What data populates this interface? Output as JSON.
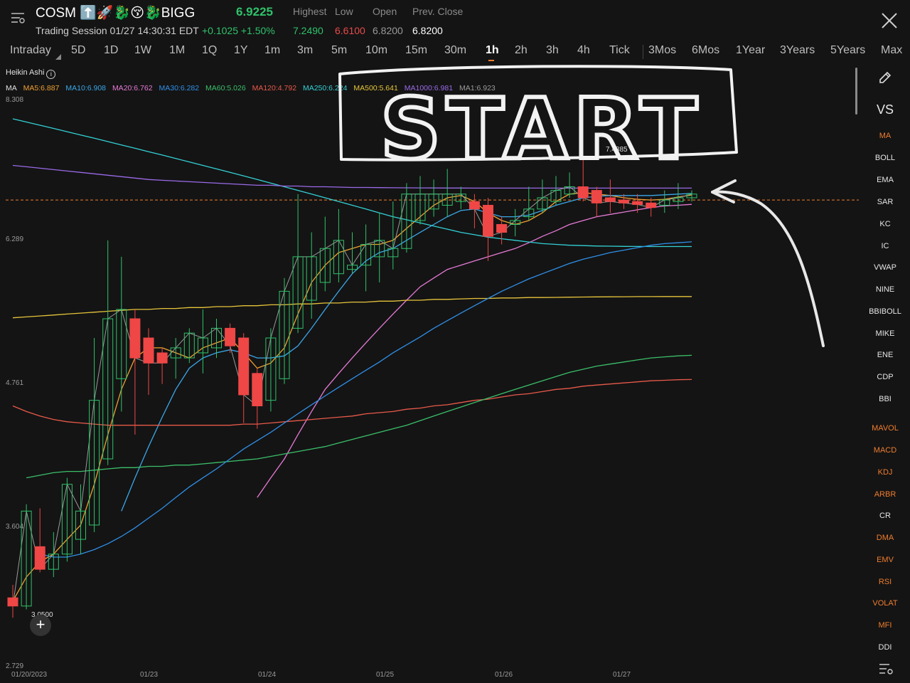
{
  "header": {
    "symbol": "COSM ⬆️🚀🐉😚🐉BIGG",
    "price": "6.9225",
    "session": "Trading Session 01/27 14:30:31 EDT",
    "change": "+0.1025 +1.50%",
    "stats": [
      {
        "label": "Highest",
        "value": "7.2490",
        "color": "#2fc26b"
      },
      {
        "label": "Low",
        "value": "6.6100",
        "color": "#e84a4a"
      },
      {
        "label": "Open",
        "value": "6.8200",
        "color": "#9a9a9a"
      },
      {
        "label": "Prev. Close",
        "value": "6.8200",
        "color": "#ffffff"
      }
    ]
  },
  "periods": [
    "Intraday",
    "5D",
    "1D",
    "1W",
    "1M",
    "1Q",
    "1Y",
    "1m",
    "3m",
    "5m",
    "10m",
    "15m",
    "30m",
    "1h",
    "2h",
    "3h",
    "4h",
    "Tick",
    "3Mos",
    "6Mos",
    "1Year",
    "3Years",
    "5Years",
    "Max"
  ],
  "active_period": "1h",
  "chart_header": {
    "style": "Heikin Ashi",
    "ma_label": "MA",
    "ma_items": [
      {
        "text": "MA5:6.887",
        "color": "#f0a030"
      },
      {
        "text": "MA10:6.908",
        "color": "#3aa7e8"
      },
      {
        "text": "MA20:6.762",
        "color": "#e67ad6"
      },
      {
        "text": "MA30:6.282",
        "color": "#2f8fe8"
      },
      {
        "text": "MA60:5.026",
        "color": "#3bbf6a"
      },
      {
        "text": "MA120:4.792",
        "color": "#e8594a"
      },
      {
        "text": "MA250:6.224",
        "color": "#33d0d6"
      },
      {
        "text": "MA500:5.641",
        "color": "#e6c43a"
      },
      {
        "text": "MA1000:6.981",
        "color": "#9a6ae8"
      },
      {
        "text": "MA1:6.923",
        "color": "#9a9a9a"
      }
    ]
  },
  "y_labels": [
    "8.308",
    "6.289",
    "4.761",
    "3.604",
    "2.729"
  ],
  "x_labels": [
    "01/20/2023",
    "01/23",
    "01/24",
    "01/25",
    "01/26",
    "01/27"
  ],
  "markers": {
    "low": "3.0500",
    "high": "7.4385"
  },
  "annotation": "START",
  "sidebar": [
    {
      "label": "MA",
      "on": true
    },
    {
      "label": "BOLL",
      "on": false
    },
    {
      "label": "EMA",
      "on": false
    },
    {
      "label": "SAR",
      "on": false
    },
    {
      "label": "KC",
      "on": false
    },
    {
      "label": "IC",
      "on": false
    },
    {
      "label": "VWAP",
      "on": false
    },
    {
      "label": "NINE",
      "on": false
    },
    {
      "label": "BBIBOLL",
      "on": false
    },
    {
      "label": "MIKE",
      "on": false
    },
    {
      "label": "ENE",
      "on": false
    },
    {
      "label": "CDP",
      "on": false
    },
    {
      "label": "BBI",
      "on": false
    },
    {
      "label": "MAVOL",
      "on": true
    },
    {
      "label": "MACD",
      "on": true
    },
    {
      "label": "KDJ",
      "on": true
    },
    {
      "label": "ARBR",
      "on": true
    },
    {
      "label": "CR",
      "on": false
    },
    {
      "label": "DMA",
      "on": true
    },
    {
      "label": "EMV",
      "on": true
    },
    {
      "label": "RSI",
      "on": true
    },
    {
      "label": "VOLAT",
      "on": true
    },
    {
      "label": "MFI",
      "on": true
    },
    {
      "label": "DDI",
      "on": false
    }
  ],
  "sidebar_vs": "VS",
  "chart_data": {
    "type": "candlestick",
    "style": "Heikin Ashi",
    "y_axis": {
      "scale": "log",
      "tick_labels": [
        "8.308",
        "6.289",
        "4.761",
        "3.604",
        "2.729"
      ],
      "range": [
        2.729,
        8.308
      ]
    },
    "prev_close": 6.82,
    "candles": [
      {
        "o": 3.12,
        "c": 3.07,
        "h": 3.2,
        "l": 3.0
      },
      {
        "o": 3.07,
        "c": 3.7,
        "h": 3.75,
        "l": 3.05
      },
      {
        "o": 3.45,
        "c": 3.3,
        "h": 3.72,
        "l": 3.28
      },
      {
        "o": 3.3,
        "c": 3.4,
        "h": 3.55,
        "l": 3.25
      },
      {
        "o": 3.4,
        "c": 3.9,
        "h": 3.95,
        "l": 3.35
      },
      {
        "o": 3.5,
        "c": 3.7,
        "h": 3.9,
        "l": 3.4
      },
      {
        "o": 3.6,
        "c": 4.6,
        "h": 5.2,
        "l": 3.55
      },
      {
        "o": 4.1,
        "c": 5.4,
        "h": 6.3,
        "l": 4.05
      },
      {
        "o": 4.8,
        "c": 5.5,
        "h": 6.1,
        "l": 4.5
      },
      {
        "o": 5.4,
        "c": 5.0,
        "h": 5.5,
        "l": 4.3
      },
      {
        "o": 5.2,
        "c": 4.95,
        "h": 5.3,
        "l": 4.65
      },
      {
        "o": 5.05,
        "c": 4.95,
        "h": 5.1,
        "l": 4.75
      },
      {
        "o": 5.0,
        "c": 5.1,
        "h": 5.2,
        "l": 4.8
      },
      {
        "o": 5.0,
        "c": 5.25,
        "h": 5.3,
        "l": 4.95
      },
      {
        "o": 5.05,
        "c": 5.2,
        "h": 5.5,
        "l": 4.85
      },
      {
        "o": 5.1,
        "c": 5.3,
        "h": 5.4,
        "l": 5.0
      },
      {
        "o": 5.3,
        "c": 5.12,
        "h": 5.35,
        "l": 5.05
      },
      {
        "o": 5.2,
        "c": 4.65,
        "h": 5.25,
        "l": 4.4
      },
      {
        "o": 4.85,
        "c": 4.55,
        "h": 4.9,
        "l": 4.35
      },
      {
        "o": 4.6,
        "c": 5.2,
        "h": 5.3,
        "l": 4.5
      },
      {
        "o": 4.8,
        "c": 5.7,
        "h": 5.85,
        "l": 4.75
      },
      {
        "o": 5.3,
        "c": 6.1,
        "h": 6.9,
        "l": 5.25
      },
      {
        "o": 5.6,
        "c": 6.1,
        "h": 6.4,
        "l": 5.4
      },
      {
        "o": 5.8,
        "c": 6.2,
        "h": 6.6,
        "l": 5.7
      },
      {
        "o": 5.9,
        "c": 6.3,
        "h": 6.7,
        "l": 5.8
      },
      {
        "o": 5.95,
        "c": 6.0,
        "h": 6.4,
        "l": 5.9
      },
      {
        "o": 6.0,
        "c": 6.25,
        "h": 6.5,
        "l": 5.7
      },
      {
        "o": 6.1,
        "c": 6.3,
        "h": 6.65,
        "l": 5.8
      },
      {
        "o": 6.1,
        "c": 6.2,
        "h": 6.8,
        "l": 5.95
      },
      {
        "o": 6.2,
        "c": 6.9,
        "h": 7.05,
        "l": 6.15
      },
      {
        "o": 6.55,
        "c": 6.9,
        "h": 7.15,
        "l": 6.5
      },
      {
        "o": 6.7,
        "c": 6.9,
        "h": 7.1,
        "l": 6.6
      },
      {
        "o": 6.75,
        "c": 6.9,
        "h": 7.25,
        "l": 6.6
      },
      {
        "o": 6.8,
        "c": 6.9,
        "h": 7.0,
        "l": 6.7
      },
      {
        "o": 6.8,
        "c": 6.7,
        "h": 6.9,
        "l": 6.45
      },
      {
        "o": 6.75,
        "c": 6.35,
        "h": 6.85,
        "l": 6.05
      },
      {
        "o": 6.5,
        "c": 6.4,
        "h": 6.6,
        "l": 6.25
      },
      {
        "o": 6.5,
        "c": 6.55,
        "h": 6.7,
        "l": 6.35
      },
      {
        "o": 6.6,
        "c": 6.7,
        "h": 7.0,
        "l": 6.55
      },
      {
        "o": 6.7,
        "c": 6.85,
        "h": 7.1,
        "l": 6.65
      },
      {
        "o": 6.8,
        "c": 6.95,
        "h": 7.15,
        "l": 6.75
      },
      {
        "o": 6.9,
        "c": 7.0,
        "h": 7.2,
        "l": 6.85
      },
      {
        "o": 7.0,
        "c": 6.85,
        "h": 7.44,
        "l": 6.8
      },
      {
        "o": 6.95,
        "c": 6.78,
        "h": 7.0,
        "l": 6.6
      },
      {
        "o": 6.85,
        "c": 6.8,
        "h": 7.1,
        "l": 6.65
      },
      {
        "o": 6.82,
        "c": 6.78,
        "h": 6.9,
        "l": 6.7
      },
      {
        "o": 6.8,
        "c": 6.76,
        "h": 6.9,
        "l": 6.65
      },
      {
        "o": 6.78,
        "c": 6.72,
        "h": 6.85,
        "l": 6.6
      },
      {
        "o": 6.75,
        "c": 6.82,
        "h": 6.95,
        "l": 6.65
      },
      {
        "o": 6.8,
        "c": 6.85,
        "h": 7.05,
        "l": 6.7
      },
      {
        "o": 6.85,
        "c": 6.9,
        "h": 6.95,
        "l": 6.8
      }
    ],
    "ma_lines": [
      {
        "name": "MA5",
        "color": "#f0a030",
        "values": [
          3.1,
          3.25,
          3.35,
          3.4,
          3.5,
          3.6,
          3.9,
          4.3,
          4.7,
          5.0,
          5.1,
          5.1,
          5.05,
          5.0,
          5.1,
          5.15,
          5.2,
          5.05,
          4.9,
          4.95,
          5.1,
          5.45,
          5.8,
          6.0,
          6.15,
          6.2,
          6.25,
          6.25,
          6.3,
          6.45,
          6.6,
          6.75,
          6.85,
          6.88,
          6.8,
          6.65,
          6.55,
          6.5,
          6.55,
          6.65,
          6.8,
          6.9,
          6.92,
          6.9,
          6.88,
          6.85,
          6.83,
          6.82,
          6.83,
          6.86,
          6.887
        ]
      },
      {
        "name": "MA10",
        "color": "#3aa7e8",
        "values": [
          null,
          null,
          null,
          null,
          null,
          null,
          null,
          null,
          3.7,
          3.95,
          4.2,
          4.45,
          4.7,
          4.9,
          5.0,
          5.05,
          5.08,
          5.05,
          5.0,
          5.0,
          5.02,
          5.12,
          5.3,
          5.5,
          5.7,
          5.9,
          6.05,
          6.15,
          6.2,
          6.3,
          6.4,
          6.5,
          6.6,
          6.68,
          6.7,
          6.65,
          6.6,
          6.6,
          6.62,
          6.68,
          6.75,
          6.8,
          6.85,
          6.87,
          6.88,
          6.88,
          6.88,
          6.88,
          6.89,
          6.9,
          6.908
        ]
      },
      {
        "name": "MA20",
        "color": "#e67ad6",
        "values": [
          null,
          null,
          null,
          null,
          null,
          null,
          null,
          null,
          null,
          null,
          null,
          null,
          null,
          null,
          null,
          null,
          null,
          null,
          3.8,
          3.95,
          4.1,
          4.3,
          4.5,
          4.7,
          4.85,
          5.0,
          5.15,
          5.3,
          5.45,
          5.6,
          5.75,
          5.85,
          5.95,
          6.0,
          6.05,
          6.1,
          6.15,
          6.2,
          6.27,
          6.35,
          6.42,
          6.5,
          6.55,
          6.6,
          6.63,
          6.66,
          6.69,
          6.72,
          6.74,
          6.75,
          6.762
        ]
      },
      {
        "name": "MA250",
        "color": "#33d0d6",
        "values": [
          8.0,
          7.95,
          7.9,
          7.85,
          7.8,
          7.75,
          7.7,
          7.65,
          7.6,
          7.55,
          7.5,
          7.45,
          7.4,
          7.35,
          7.3,
          7.25,
          7.2,
          7.15,
          7.1,
          7.05,
          7.0,
          6.95,
          6.9,
          6.85,
          6.8,
          6.75,
          6.7,
          6.65,
          6.6,
          6.56,
          6.52,
          6.48,
          6.44,
          6.4,
          6.37,
          6.34,
          6.32,
          6.3,
          6.28,
          6.26,
          6.25,
          6.24,
          6.235,
          6.23,
          6.228,
          6.226,
          6.225,
          6.224,
          6.224,
          6.224,
          6.224
        ]
      },
      {
        "name": "MA500",
        "color": "#e6c43a",
        "values": [
          5.41,
          5.42,
          5.43,
          5.44,
          5.45,
          5.46,
          5.47,
          5.48,
          5.49,
          5.5,
          5.5,
          5.51,
          5.51,
          5.52,
          5.52,
          5.53,
          5.53,
          5.54,
          5.54,
          5.55,
          5.55,
          5.56,
          5.56,
          5.57,
          5.57,
          5.58,
          5.58,
          5.59,
          5.59,
          5.6,
          5.6,
          5.61,
          5.61,
          5.615,
          5.62,
          5.62,
          5.625,
          5.625,
          5.63,
          5.63,
          5.632,
          5.634,
          5.636,
          5.637,
          5.638,
          5.639,
          5.64,
          5.64,
          5.641,
          5.641,
          5.641
        ]
      },
      {
        "name": "MA1000",
        "color": "#9a6ae8",
        "values": [
          7.3,
          7.28,
          7.26,
          7.24,
          7.22,
          7.2,
          7.18,
          7.16,
          7.14,
          7.12,
          7.1,
          7.09,
          7.08,
          7.07,
          7.06,
          7.05,
          7.04,
          7.03,
          7.02,
          7.02,
          7.01,
          7.01,
          7.0,
          7.0,
          6.995,
          6.99,
          6.99,
          6.988,
          6.986,
          6.985,
          6.984,
          6.983,
          6.982,
          6.982,
          6.981,
          6.981,
          6.981,
          6.981,
          6.981,
          6.981,
          6.981,
          6.981,
          6.981,
          6.981,
          6.981,
          6.981,
          6.981,
          6.981,
          6.981,
          6.981,
          6.981
        ]
      },
      {
        "name": "MA120",
        "color": "#e8594a",
        "values": [
          4.55,
          4.5,
          4.46,
          4.43,
          4.41,
          4.4,
          4.39,
          4.38,
          4.38,
          4.38,
          4.38,
          4.38,
          4.38,
          4.38,
          4.38,
          4.38,
          4.38,
          4.39,
          4.39,
          4.4,
          4.41,
          4.42,
          4.43,
          4.44,
          4.45,
          4.46,
          4.48,
          4.49,
          4.5,
          4.52,
          4.53,
          4.55,
          4.56,
          4.58,
          4.6,
          4.61,
          4.63,
          4.65,
          4.66,
          4.68,
          4.7,
          4.71,
          4.73,
          4.74,
          4.75,
          4.76,
          4.77,
          4.78,
          4.785,
          4.79,
          4.792
        ]
      },
      {
        "name": "MA60",
        "color": "#3bbf6a",
        "values": [
          null,
          3.95,
          3.97,
          3.99,
          4.0,
          4.0,
          4.01,
          4.02,
          4.03,
          4.03,
          4.04,
          4.04,
          4.05,
          4.05,
          4.06,
          4.07,
          4.08,
          4.09,
          4.1,
          4.12,
          4.14,
          4.16,
          4.18,
          4.2,
          4.23,
          4.26,
          4.29,
          4.32,
          4.35,
          4.38,
          4.42,
          4.46,
          4.5,
          4.54,
          4.58,
          4.62,
          4.66,
          4.7,
          4.74,
          4.78,
          4.82,
          4.86,
          4.89,
          4.92,
          4.94,
          4.96,
          4.98,
          5.0,
          5.01,
          5.02,
          5.026
        ]
      },
      {
        "name": "MA30",
        "color": "#2f8fe8",
        "values": [
          null,
          null,
          3.4,
          3.38,
          3.38,
          3.4,
          3.43,
          3.47,
          3.52,
          3.58,
          3.65,
          3.72,
          3.8,
          3.88,
          3.95,
          4.02,
          4.1,
          4.18,
          4.25,
          4.32,
          4.4,
          4.48,
          4.56,
          4.64,
          4.72,
          4.8,
          4.88,
          4.96,
          5.05,
          5.13,
          5.21,
          5.3,
          5.38,
          5.46,
          5.54,
          5.62,
          5.7,
          5.77,
          5.84,
          5.9,
          5.96,
          6.02,
          6.07,
          6.11,
          6.15,
          6.18,
          6.21,
          6.24,
          6.26,
          6.27,
          6.282
        ]
      }
    ]
  }
}
